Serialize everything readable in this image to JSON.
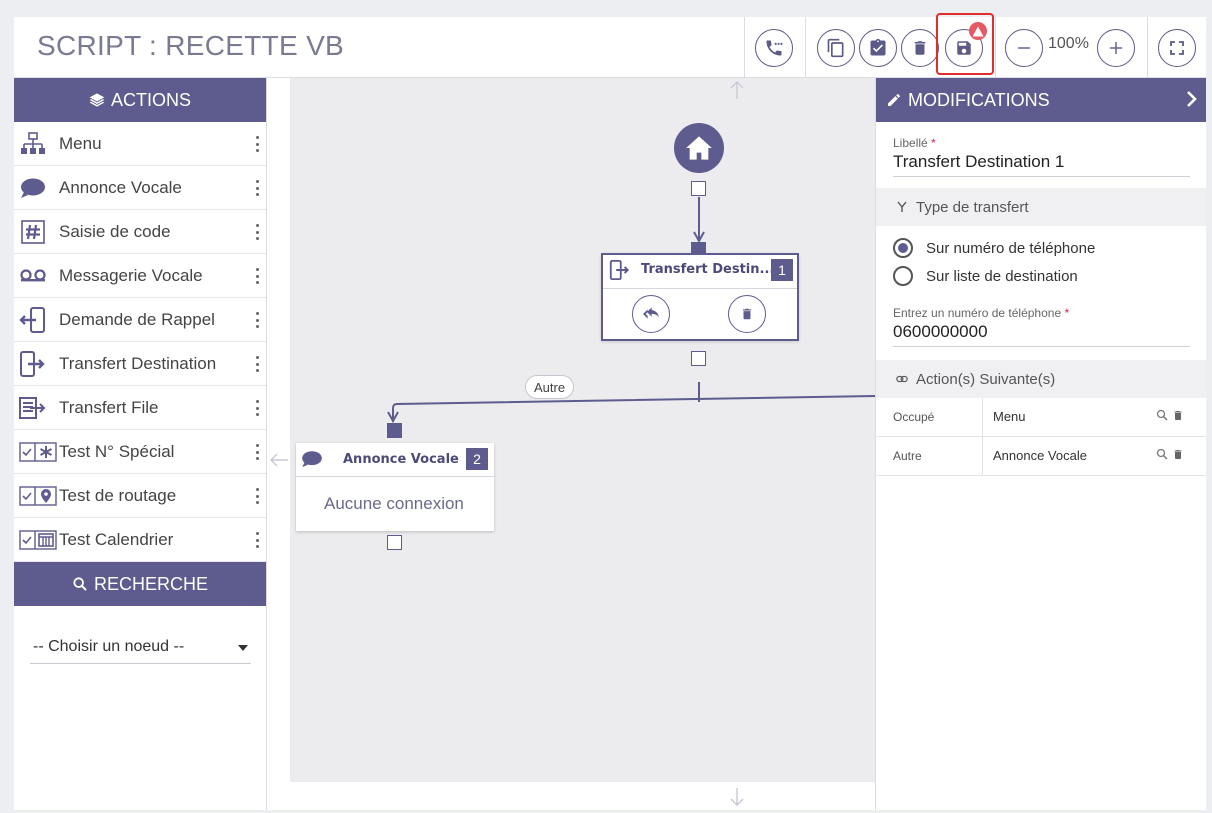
{
  "header": {
    "title": "SCRIPT : RECETTE VB",
    "zoom": "100%"
  },
  "actions": {
    "heading": "ACTIONS",
    "items": [
      {
        "label": "Menu",
        "icon": "sitemap-icon"
      },
      {
        "label": "Annonce Vocale",
        "icon": "speech-bubble-icon"
      },
      {
        "label": "Saisie de code",
        "icon": "hash-icon"
      },
      {
        "label": "Messagerie Vocale",
        "icon": "voicemail-icon"
      },
      {
        "label": "Demande de Rappel",
        "icon": "callback-icon"
      },
      {
        "label": "Transfert Destination",
        "icon": "transfer-icon"
      },
      {
        "label": "Transfert File",
        "icon": "queue-transfer-icon"
      },
      {
        "label": "Test N° Spécial",
        "icon": "test-special-icon"
      },
      {
        "label": "Test de routage",
        "icon": "test-routing-icon"
      },
      {
        "label": "Test Calendrier",
        "icon": "test-calendar-icon"
      }
    ]
  },
  "search": {
    "heading": "RECHERCHE",
    "select_value": "-- Choisir un noeud --"
  },
  "canvas": {
    "node1": {
      "title": "Transfert Destin...",
      "number": "1"
    },
    "node2": {
      "title": "Annonce Vocale",
      "number": "2",
      "empty_text": "Aucune connexion"
    },
    "edge_label": "Autre"
  },
  "modifications": {
    "heading": "MODIFICATIONS",
    "libelle_label": "Libellé",
    "libelle_value": "Transfert Destination 1",
    "type_section": "Type de transfert",
    "radio_options": [
      "Sur numéro de téléphone",
      "Sur liste de destination"
    ],
    "selected_option": "Sur numéro de téléphone",
    "phone_label": "Entrez un numéro de téléphone",
    "phone_value": "0600000000",
    "next_section": "Action(s) Suivante(s)",
    "next_actions": [
      {
        "condition": "Occupé",
        "action": "Menu"
      },
      {
        "condition": "Autre",
        "action": "Annonce Vocale"
      }
    ]
  },
  "colors": {
    "accent": "#5e5c8f",
    "warning": "#e55a64",
    "highlight": "#e22d2d"
  }
}
